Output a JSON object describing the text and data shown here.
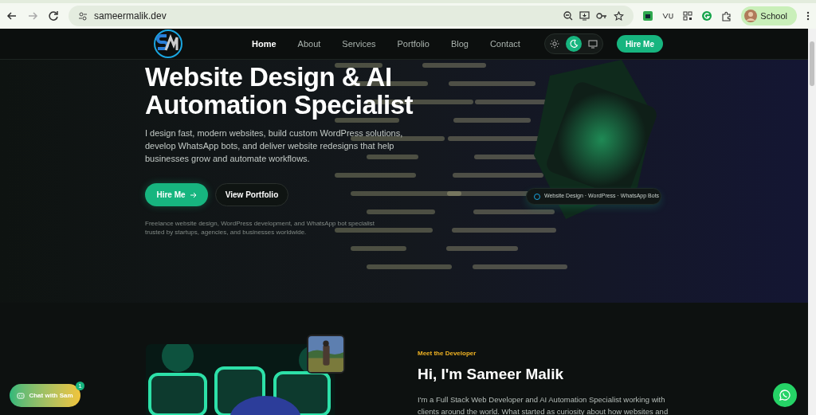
{
  "browser": {
    "url": "sameermalik.dev",
    "profile": "School"
  },
  "nav": {
    "links": [
      {
        "label": "Home",
        "selected": true
      },
      {
        "label": "About",
        "selected": false
      },
      {
        "label": "Services",
        "selected": false
      },
      {
        "label": "Portfolio",
        "selected": false
      },
      {
        "label": "Blog",
        "selected": false
      },
      {
        "label": "Contact",
        "selected": false
      }
    ],
    "theme_options": [
      {
        "kind": "light",
        "selected": false
      },
      {
        "kind": "dark",
        "selected": true
      },
      {
        "kind": "system",
        "selected": false
      }
    ],
    "cta": "Hire Me"
  },
  "hero": {
    "title_lines": [
      "Website Design & AI",
      "Automation Specialist"
    ],
    "description": "I design fast, modern websites, build custom WordPress solutions, develop WhatsApp bots, and deliver website redesigns that help businesses grow and automate workflows.",
    "buttons": [
      {
        "label": "Hire Me",
        "kind": "primary"
      },
      {
        "label": "View Portfolio",
        "kind": "secondary"
      }
    ],
    "note": "Freelance website design, WordPress development, and WhatsApp bot specialist trusted by startups, agencies, and businesses worldwide.",
    "tag": "Website Design · WordPress · WhatsApp Bots"
  },
  "about": {
    "eyebrow": "Meet the Developer",
    "heading": "Hi, I'm Sameer Malik",
    "text": "I'm a Full Stack Web Developer and AI Automation Specialist working with clients around the world. What started as curiosity about how websites and"
  },
  "chat": {
    "label": "Chat with Sam",
    "badge": "1"
  }
}
